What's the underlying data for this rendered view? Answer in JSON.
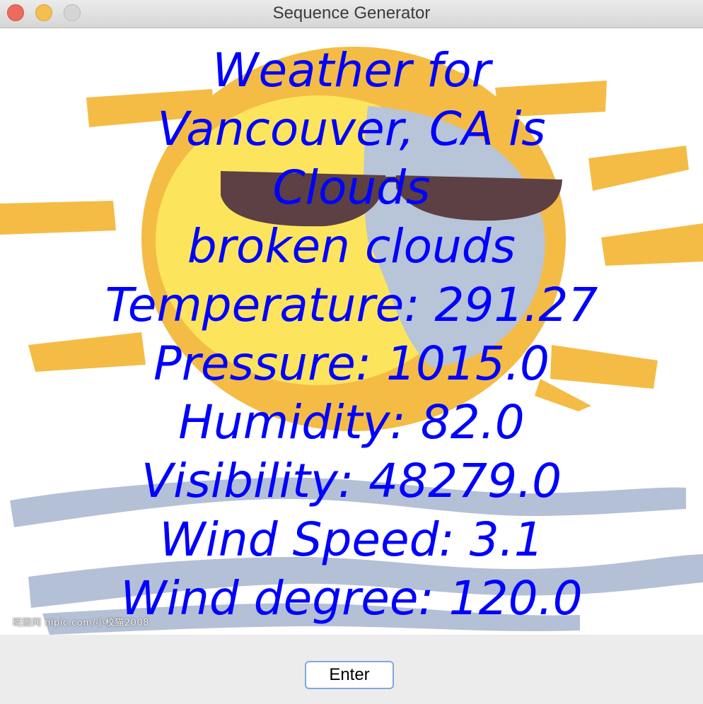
{
  "window": {
    "title": "Sequence Generator"
  },
  "weather": {
    "heading_line1": "Weather for",
    "heading_line2": "Vancouver, CA is",
    "main": "Clouds",
    "description": "broken clouds",
    "temperature": "Temperature: 291.27",
    "pressure": "Pressure: 1015.0",
    "humidity": "Humidity: 82.0",
    "visibility": "Visibility: 48279.0",
    "wind_speed": "Wind Speed: 3.1",
    "wind_degree": "Wind degree: 120.0"
  },
  "background": {
    "icon": "sun-with-sunglasses-and-waves-illustration",
    "watermark": "昵图网 nipic.com/小校猫2008",
    "colors": {
      "sun_ray": "#f4bc45",
      "sun_face": "#fce55c",
      "moon_face": "#b8c4d8",
      "sunglasses": "#5c4043",
      "waves": "#b4c0d6"
    }
  },
  "controls": {
    "enter_label": "Enter"
  },
  "theme": {
    "text_color": "#0000ff"
  }
}
